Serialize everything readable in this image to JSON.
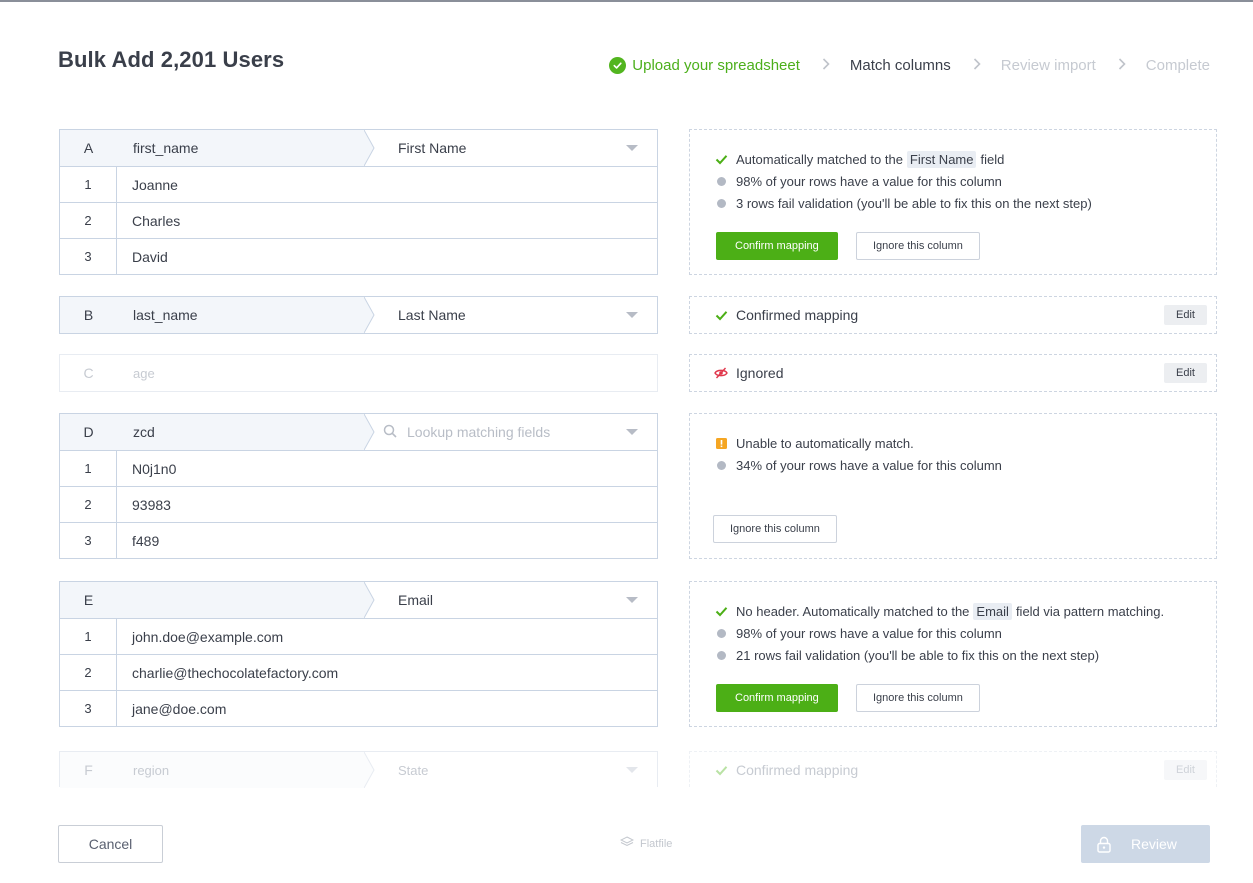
{
  "header": {
    "title": "Bulk Add 2,201 Users",
    "steps": [
      {
        "label": "Upload your spreadsheet",
        "state": "done"
      },
      {
        "label": "Match columns",
        "state": "active"
      },
      {
        "label": "Review import",
        "state": "todo"
      },
      {
        "label": "Complete",
        "state": "todo"
      }
    ]
  },
  "columns": {
    "A": {
      "letter": "A",
      "name": "first_name",
      "mapped": "First Name",
      "rows": [
        {
          "n": "1",
          "v": "Joanne"
        },
        {
          "n": "2",
          "v": "Charles"
        },
        {
          "n": "3",
          "v": "David"
        }
      ],
      "panel": {
        "msg_prefix": "Automatically matched to the",
        "field": "First Name",
        "msg_suffix": "field",
        "info1": "98% of your rows have a value for this column",
        "info2": "3 rows fail validation (you'll be able to fix this on the next step)",
        "confirm": "Confirm mapping",
        "ignore": "Ignore this column"
      }
    },
    "B": {
      "letter": "B",
      "name": "last_name",
      "mapped": "Last Name",
      "panel": {
        "status": "Confirmed mapping",
        "edit": "Edit"
      }
    },
    "C": {
      "letter": "C",
      "name": "age",
      "panel": {
        "status": "Ignored",
        "edit": "Edit"
      }
    },
    "D": {
      "letter": "D",
      "name": "zcd",
      "search_placeholder": "Lookup matching fields",
      "rows": [
        {
          "n": "1",
          "v": "N0j1n0"
        },
        {
          "n": "2",
          "v": "93983"
        },
        {
          "n": "3",
          "v": "f489"
        }
      ],
      "panel": {
        "warning": "Unable to automatically match.",
        "info1": "34% of your rows have a value for this column",
        "ignore": "Ignore this column"
      }
    },
    "E": {
      "letter": "E",
      "name": "",
      "mapped": "Email",
      "rows": [
        {
          "n": "1",
          "v": "john.doe@example.com"
        },
        {
          "n": "2",
          "v": "charlie@thechocolatefactory.com"
        },
        {
          "n": "3",
          "v": "jane@doe.com"
        }
      ],
      "panel": {
        "msg_prefix": "No header. Automatically matched to the",
        "field": "Email",
        "msg_suffix": "field via pattern matching.",
        "info1": "98% of your rows have a value for this column",
        "info2": "21 rows fail validation (you'll be able to fix this on the next step)",
        "confirm": "Confirm mapping",
        "ignore": "Ignore this column"
      }
    },
    "F": {
      "letter": "F",
      "name": "region",
      "mapped": "State",
      "panel": {
        "status": "Confirmed mapping",
        "edit": "Edit"
      }
    }
  },
  "footer": {
    "cancel": "Cancel",
    "brand": "Flatfile",
    "review": "Review"
  },
  "colors": {
    "green": "#4caf16",
    "border": "#c9d4e3",
    "review_bg": "#cdd8e6",
    "warn": "#f5a623",
    "ignored": "#e0364b"
  }
}
